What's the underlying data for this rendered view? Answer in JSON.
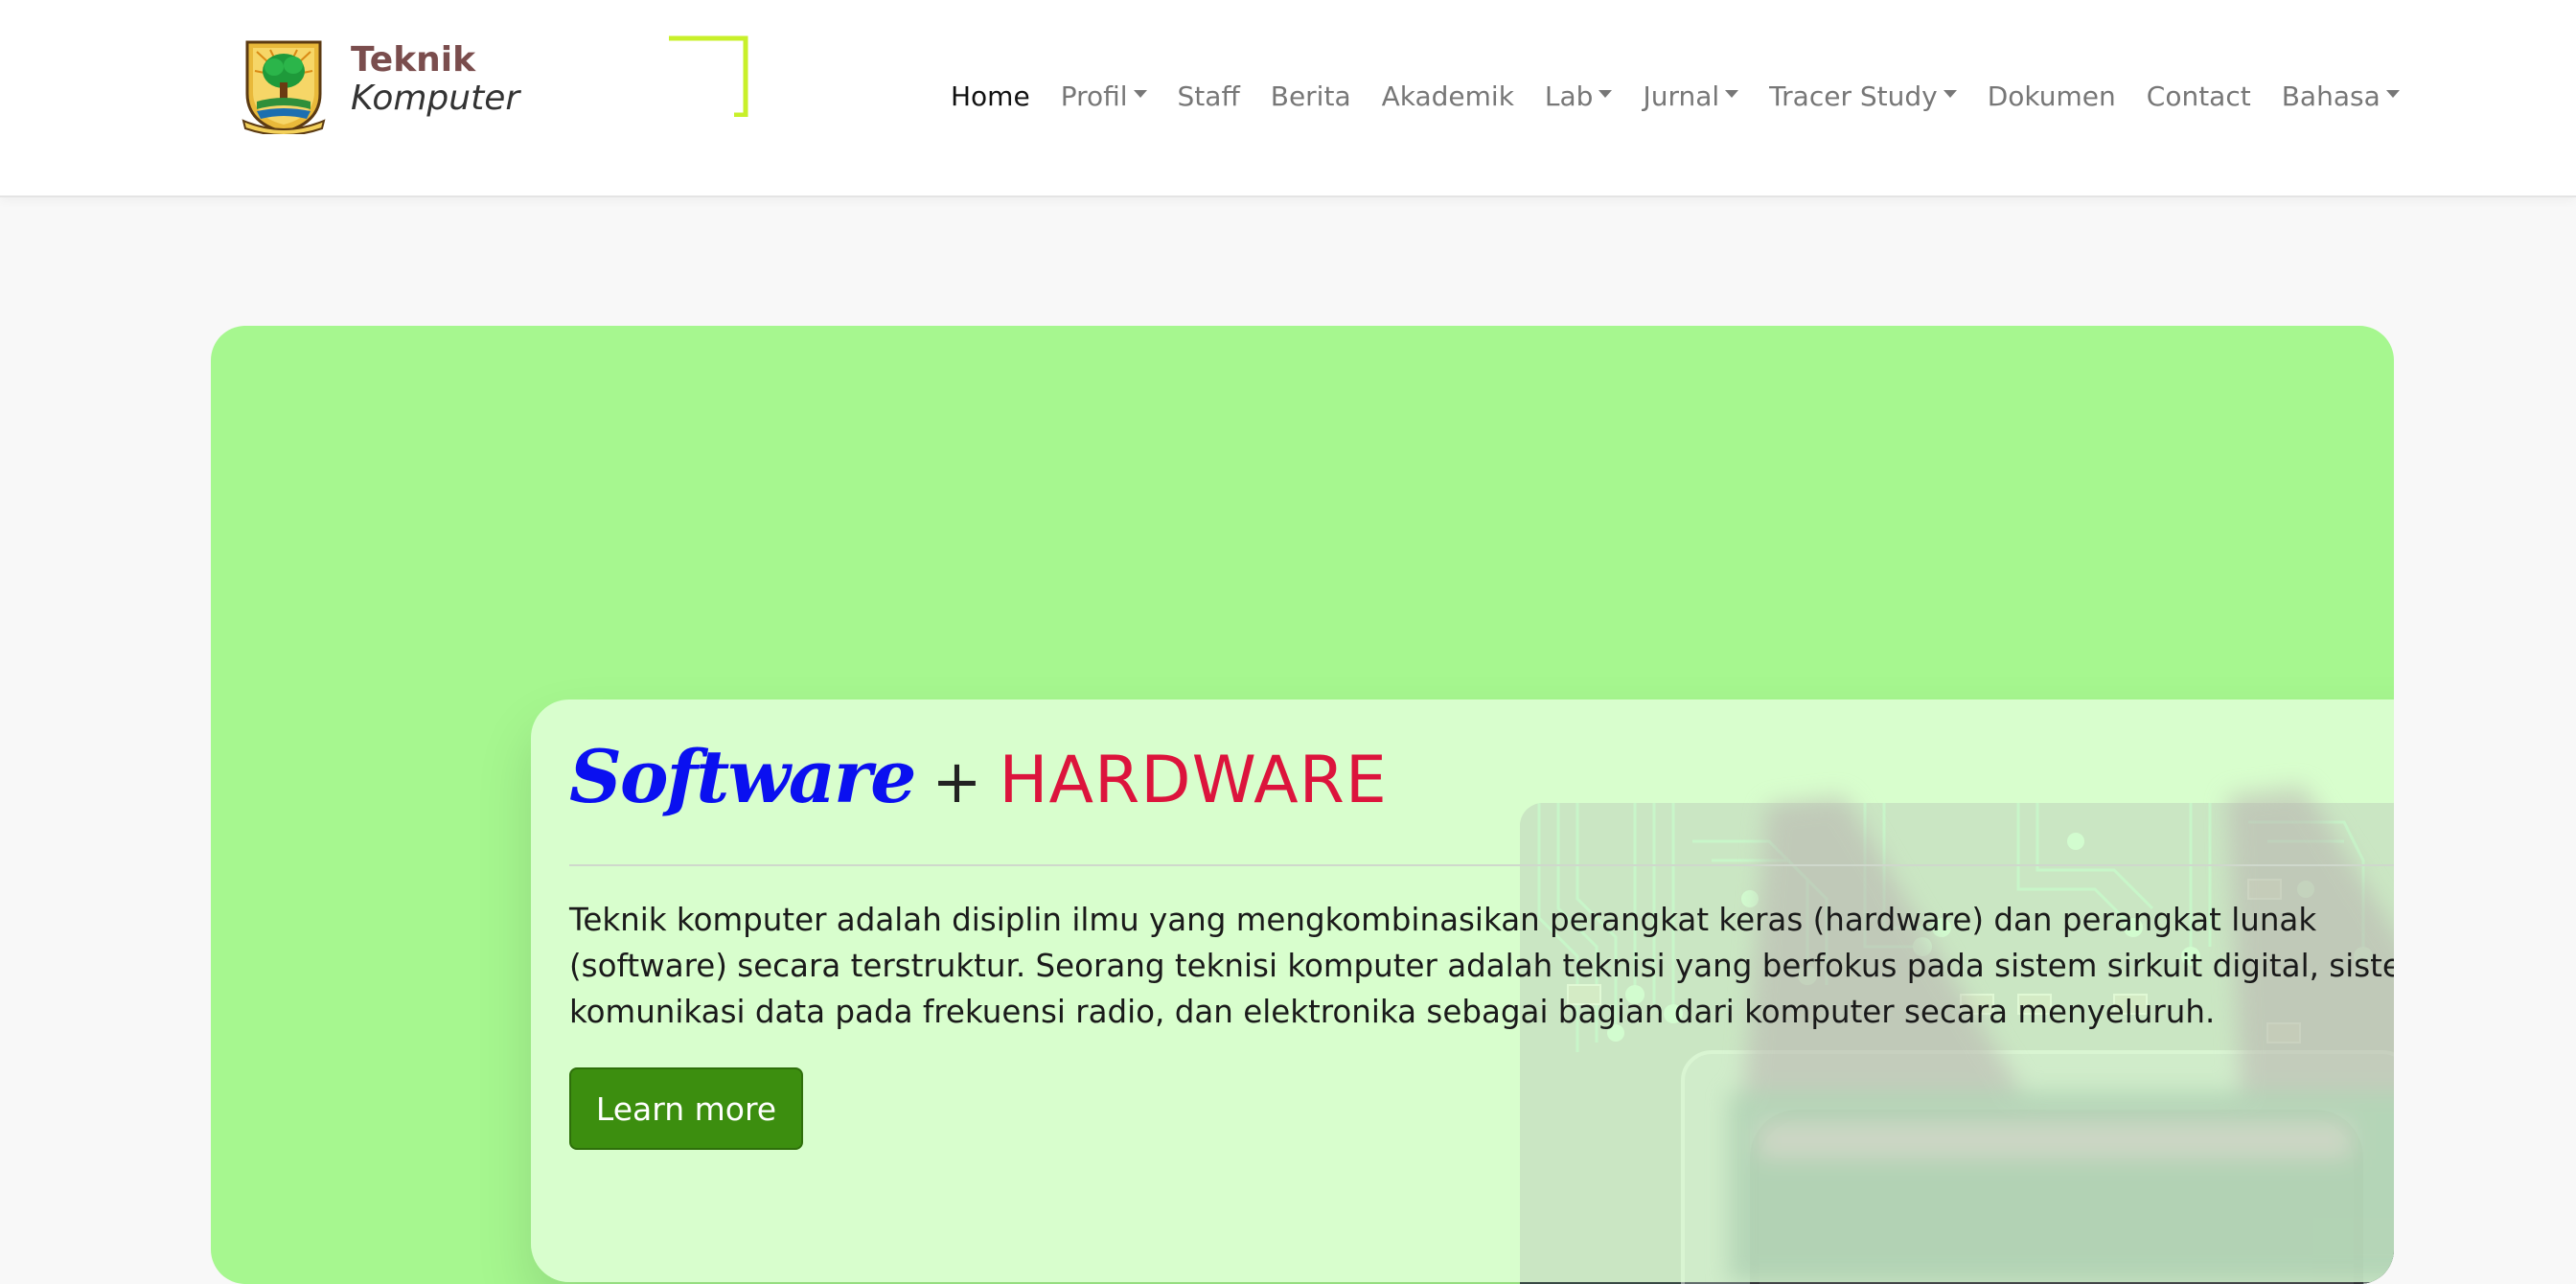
{
  "brand": {
    "line1": "Teknik",
    "line2": "Komputer"
  },
  "nav": {
    "items": [
      {
        "label": "Home",
        "dropdown": false,
        "active": true
      },
      {
        "label": "Profil",
        "dropdown": true
      },
      {
        "label": "Staff",
        "dropdown": false
      },
      {
        "label": "Berita",
        "dropdown": false
      },
      {
        "label": "Akademik",
        "dropdown": false
      },
      {
        "label": "Lab",
        "dropdown": true
      },
      {
        "label": "Jurnal",
        "dropdown": true
      },
      {
        "label": "Tracer Study",
        "dropdown": true
      },
      {
        "label": "Dokumen",
        "dropdown": false
      },
      {
        "label": "Contact",
        "dropdown": false
      },
      {
        "label": "Bahasa",
        "dropdown": true
      }
    ]
  },
  "hero": {
    "title_software": "Software",
    "title_plus": "+",
    "title_hardware": "HARDWARE",
    "description": "Teknik komputer adalah disiplin ilmu yang mengkombinasikan perangkat keras (hardware) dan perangkat lunak (software) secara terstruktur. Seorang teknisi komputer adalah teknisi yang berfokus pada sistem sirkuit digital, sistem komunikasi data pada frekuensi radio, dan elektronika sebagai bagian dari komputer secara menyeluruh.",
    "button_label": "Learn more"
  },
  "colors": {
    "hero_background": "#a6f78f",
    "title_software": "#0a10f0",
    "title_hardware": "#dc143c",
    "button": "#3c8e0f",
    "brand_text": "#7a4d4d",
    "brand_accent": "#c8f02a"
  },
  "icons": {
    "logo": "university-crest-icon",
    "caret": "caret-down-icon",
    "hero_image": "circuit-board-image"
  }
}
